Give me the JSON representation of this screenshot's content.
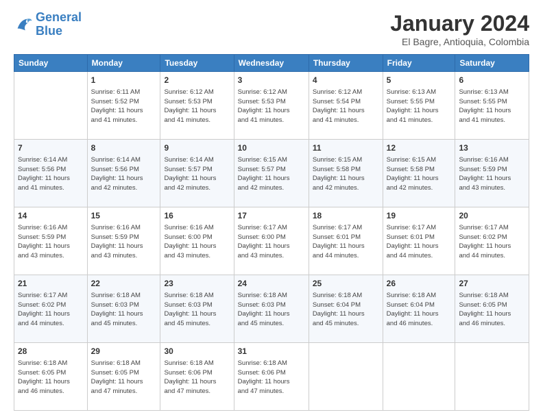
{
  "header": {
    "logo_general": "General",
    "logo_blue": "Blue",
    "title": "January 2024",
    "subtitle": "El Bagre, Antioquia, Colombia"
  },
  "weekdays": [
    "Sunday",
    "Monday",
    "Tuesday",
    "Wednesday",
    "Thursday",
    "Friday",
    "Saturday"
  ],
  "weeks": [
    [
      {
        "day": "",
        "info": ""
      },
      {
        "day": "1",
        "info": "Sunrise: 6:11 AM\nSunset: 5:52 PM\nDaylight: 11 hours\nand 41 minutes."
      },
      {
        "day": "2",
        "info": "Sunrise: 6:12 AM\nSunset: 5:53 PM\nDaylight: 11 hours\nand 41 minutes."
      },
      {
        "day": "3",
        "info": "Sunrise: 6:12 AM\nSunset: 5:53 PM\nDaylight: 11 hours\nand 41 minutes."
      },
      {
        "day": "4",
        "info": "Sunrise: 6:12 AM\nSunset: 5:54 PM\nDaylight: 11 hours\nand 41 minutes."
      },
      {
        "day": "5",
        "info": "Sunrise: 6:13 AM\nSunset: 5:55 PM\nDaylight: 11 hours\nand 41 minutes."
      },
      {
        "day": "6",
        "info": "Sunrise: 6:13 AM\nSunset: 5:55 PM\nDaylight: 11 hours\nand 41 minutes."
      }
    ],
    [
      {
        "day": "7",
        "info": "Sunrise: 6:14 AM\nSunset: 5:56 PM\nDaylight: 11 hours\nand 41 minutes."
      },
      {
        "day": "8",
        "info": "Sunrise: 6:14 AM\nSunset: 5:56 PM\nDaylight: 11 hours\nand 42 minutes."
      },
      {
        "day": "9",
        "info": "Sunrise: 6:14 AM\nSunset: 5:57 PM\nDaylight: 11 hours\nand 42 minutes."
      },
      {
        "day": "10",
        "info": "Sunrise: 6:15 AM\nSunset: 5:57 PM\nDaylight: 11 hours\nand 42 minutes."
      },
      {
        "day": "11",
        "info": "Sunrise: 6:15 AM\nSunset: 5:58 PM\nDaylight: 11 hours\nand 42 minutes."
      },
      {
        "day": "12",
        "info": "Sunrise: 6:15 AM\nSunset: 5:58 PM\nDaylight: 11 hours\nand 42 minutes."
      },
      {
        "day": "13",
        "info": "Sunrise: 6:16 AM\nSunset: 5:59 PM\nDaylight: 11 hours\nand 43 minutes."
      }
    ],
    [
      {
        "day": "14",
        "info": "Sunrise: 6:16 AM\nSunset: 5:59 PM\nDaylight: 11 hours\nand 43 minutes."
      },
      {
        "day": "15",
        "info": "Sunrise: 6:16 AM\nSunset: 5:59 PM\nDaylight: 11 hours\nand 43 minutes."
      },
      {
        "day": "16",
        "info": "Sunrise: 6:16 AM\nSunset: 6:00 PM\nDaylight: 11 hours\nand 43 minutes."
      },
      {
        "day": "17",
        "info": "Sunrise: 6:17 AM\nSunset: 6:00 PM\nDaylight: 11 hours\nand 43 minutes."
      },
      {
        "day": "18",
        "info": "Sunrise: 6:17 AM\nSunset: 6:01 PM\nDaylight: 11 hours\nand 44 minutes."
      },
      {
        "day": "19",
        "info": "Sunrise: 6:17 AM\nSunset: 6:01 PM\nDaylight: 11 hours\nand 44 minutes."
      },
      {
        "day": "20",
        "info": "Sunrise: 6:17 AM\nSunset: 6:02 PM\nDaylight: 11 hours\nand 44 minutes."
      }
    ],
    [
      {
        "day": "21",
        "info": "Sunrise: 6:17 AM\nSunset: 6:02 PM\nDaylight: 11 hours\nand 44 minutes."
      },
      {
        "day": "22",
        "info": "Sunrise: 6:18 AM\nSunset: 6:03 PM\nDaylight: 11 hours\nand 45 minutes."
      },
      {
        "day": "23",
        "info": "Sunrise: 6:18 AM\nSunset: 6:03 PM\nDaylight: 11 hours\nand 45 minutes."
      },
      {
        "day": "24",
        "info": "Sunrise: 6:18 AM\nSunset: 6:03 PM\nDaylight: 11 hours\nand 45 minutes."
      },
      {
        "day": "25",
        "info": "Sunrise: 6:18 AM\nSunset: 6:04 PM\nDaylight: 11 hours\nand 45 minutes."
      },
      {
        "day": "26",
        "info": "Sunrise: 6:18 AM\nSunset: 6:04 PM\nDaylight: 11 hours\nand 46 minutes."
      },
      {
        "day": "27",
        "info": "Sunrise: 6:18 AM\nSunset: 6:05 PM\nDaylight: 11 hours\nand 46 minutes."
      }
    ],
    [
      {
        "day": "28",
        "info": "Sunrise: 6:18 AM\nSunset: 6:05 PM\nDaylight: 11 hours\nand 46 minutes."
      },
      {
        "day": "29",
        "info": "Sunrise: 6:18 AM\nSunset: 6:05 PM\nDaylight: 11 hours\nand 47 minutes."
      },
      {
        "day": "30",
        "info": "Sunrise: 6:18 AM\nSunset: 6:06 PM\nDaylight: 11 hours\nand 47 minutes."
      },
      {
        "day": "31",
        "info": "Sunrise: 6:18 AM\nSunset: 6:06 PM\nDaylight: 11 hours\nand 47 minutes."
      },
      {
        "day": "",
        "info": ""
      },
      {
        "day": "",
        "info": ""
      },
      {
        "day": "",
        "info": ""
      }
    ]
  ]
}
